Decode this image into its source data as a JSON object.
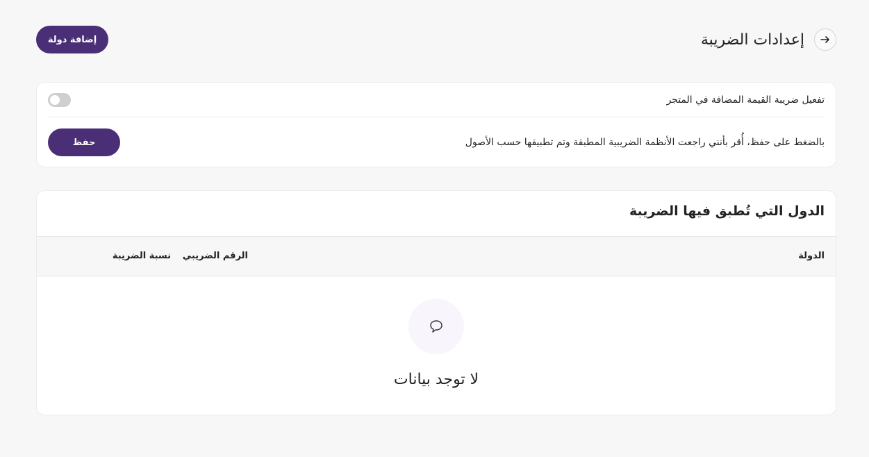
{
  "header": {
    "title": "إعدادات الضريبة",
    "back_icon": "arrow-right-icon",
    "add_country_label": "إضافة دولة"
  },
  "settings": {
    "vat_toggle_label": "تفعيل ضريبة القيمة المضافة في المتجر",
    "vat_enabled": false,
    "acknowledgement": "بالضغط على حفظ، أُقر بأنني راجعت الأنظمة الضريبية المطبقة وتم تطبيقها حسب الأصول",
    "save_label": "حفظ"
  },
  "countries": {
    "title": "الدول التي تُطبق فيها الضريبة",
    "columns": {
      "country": "الدولة",
      "tax_number": "الرقم الضريبي",
      "tax_rate": "نسبة الضريبة"
    },
    "rows": [],
    "empty_icon": "chat-bubble-icon",
    "empty_text": "لا توجد بيانات"
  },
  "colors": {
    "primary": "#4a2f77",
    "background": "#f7f7f7",
    "toggle_off": "#cfcfcf",
    "empty_circle": "#f8f5fd"
  }
}
